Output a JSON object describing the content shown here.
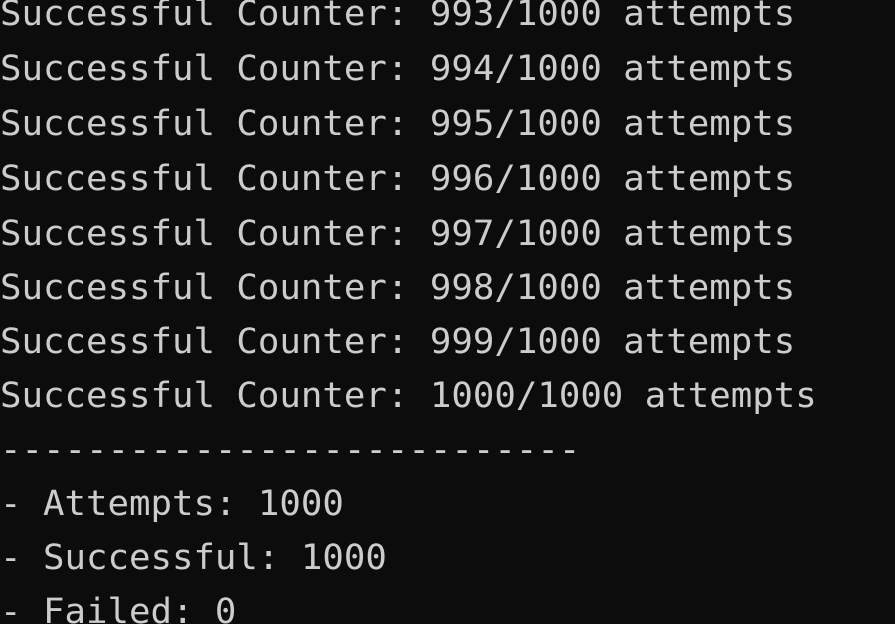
{
  "terminal": {
    "lines": [
      "Successful Counter: 993/1000 attempts",
      "Successful Counter: 994/1000 attempts",
      "Successful Counter: 995/1000 attempts",
      "Successful Counter: 996/1000 attempts",
      "Successful Counter: 997/1000 attempts",
      "Successful Counter: 998/1000 attempts",
      "Successful Counter: 999/1000 attempts",
      "Successful Counter: 1000/1000 attempts",
      "---------------------------",
      "- Attempts: 1000",
      "- Successful: 1000",
      "- Failed: 0"
    ]
  },
  "colors": {
    "background": "#0c0c0c",
    "text": "#cccccc"
  }
}
